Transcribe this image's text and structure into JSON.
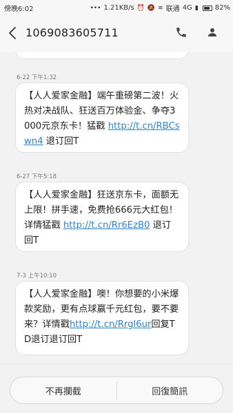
{
  "status_bar": {
    "time": "傍晚6:02",
    "speed": "1.21KB/s",
    "carrier": "联通",
    "network": "4G",
    "battery_percent": "82%",
    "battery_level": 0.82
  },
  "header": {
    "title": "1069083605711",
    "icons": [
      "back-arrow",
      "phone",
      "contact"
    ]
  },
  "messages": [
    {
      "timestamp": "6-22 下午1:32",
      "text_before": "【人人爱家金融】端午重磅第二波！火热对决战队、狂送百万体验金、争夺3000元京东卡！猛戳 ",
      "link": "http://t.cn/RBCswn4",
      "text_after": " 退订回T"
    },
    {
      "timestamp": "6-27 下午5:18",
      "text_before": "【人人爱家金融】狂送京东卡，面额无上限！拼手速，免费抢666元大红包！详情猛戳 ",
      "link": "http://t.cn/Rr6EzB0",
      "text_after": " 退订回T"
    },
    {
      "timestamp": "7-3 上午10:10",
      "text_before": "【人人爱家金融】噢！你想要的小米爆款奖励，更有点球赢千元红包，要不要来？详情戳",
      "link": "http://t.cn/Rrgl6ur",
      "text_after": "回复TD退订退订回T"
    }
  ],
  "bottom_bar": {
    "left_label": "不再攔截",
    "right_label": "回復簡訊"
  },
  "colors": {
    "link": "#2a84d0",
    "bubble_bg": "#ffffff",
    "page_bg": "#f2f2f2"
  }
}
